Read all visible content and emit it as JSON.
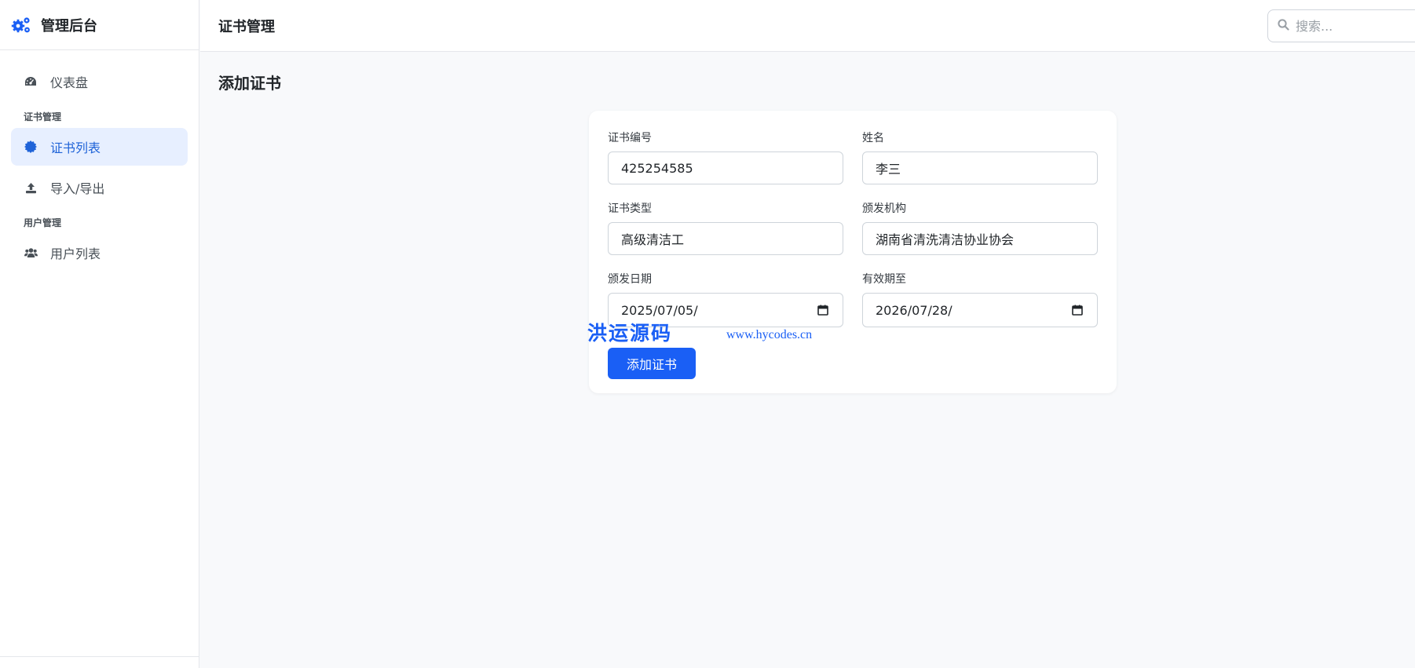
{
  "sidebar": {
    "brand_title": "管理后台",
    "brand_icon": "gears-icon",
    "items": [
      {
        "label": "仪表盘",
        "icon": "tachometer-icon",
        "active": false
      },
      {
        "section": "证书管理"
      },
      {
        "label": "证书列表",
        "icon": "certificate-icon",
        "active": true
      },
      {
        "label": "导入/导出",
        "icon": "upload-icon",
        "active": false
      },
      {
        "section": "用户管理"
      },
      {
        "label": "用户列表",
        "icon": "users-icon",
        "active": false
      }
    ]
  },
  "header": {
    "title": "证书管理",
    "search_placeholder": "搜索..."
  },
  "main": {
    "page_title": "添加证书",
    "form": {
      "cert_no": {
        "label": "证书编号",
        "value": "425254585"
      },
      "name": {
        "label": "姓名",
        "value": "李三"
      },
      "cert_type": {
        "label": "证书类型",
        "value": "高级清洁工"
      },
      "issuer": {
        "label": "颁发机构",
        "value": "湖南省清洗清洁协业协会"
      },
      "issue_date": {
        "label": "颁发日期",
        "value": "2025/07/05/"
      },
      "expire_date": {
        "label": "有效期至",
        "value": "2026/07/28/"
      },
      "submit_label": "添加证书"
    }
  },
  "watermark": {
    "text_cn": "洪运源码",
    "url": "www.hycodes.cn"
  },
  "colors": {
    "accent": "#1a5ff5",
    "active_bg": "#e7efff",
    "active_text": "#1f63d8",
    "page_bg": "#f8f9fb"
  }
}
